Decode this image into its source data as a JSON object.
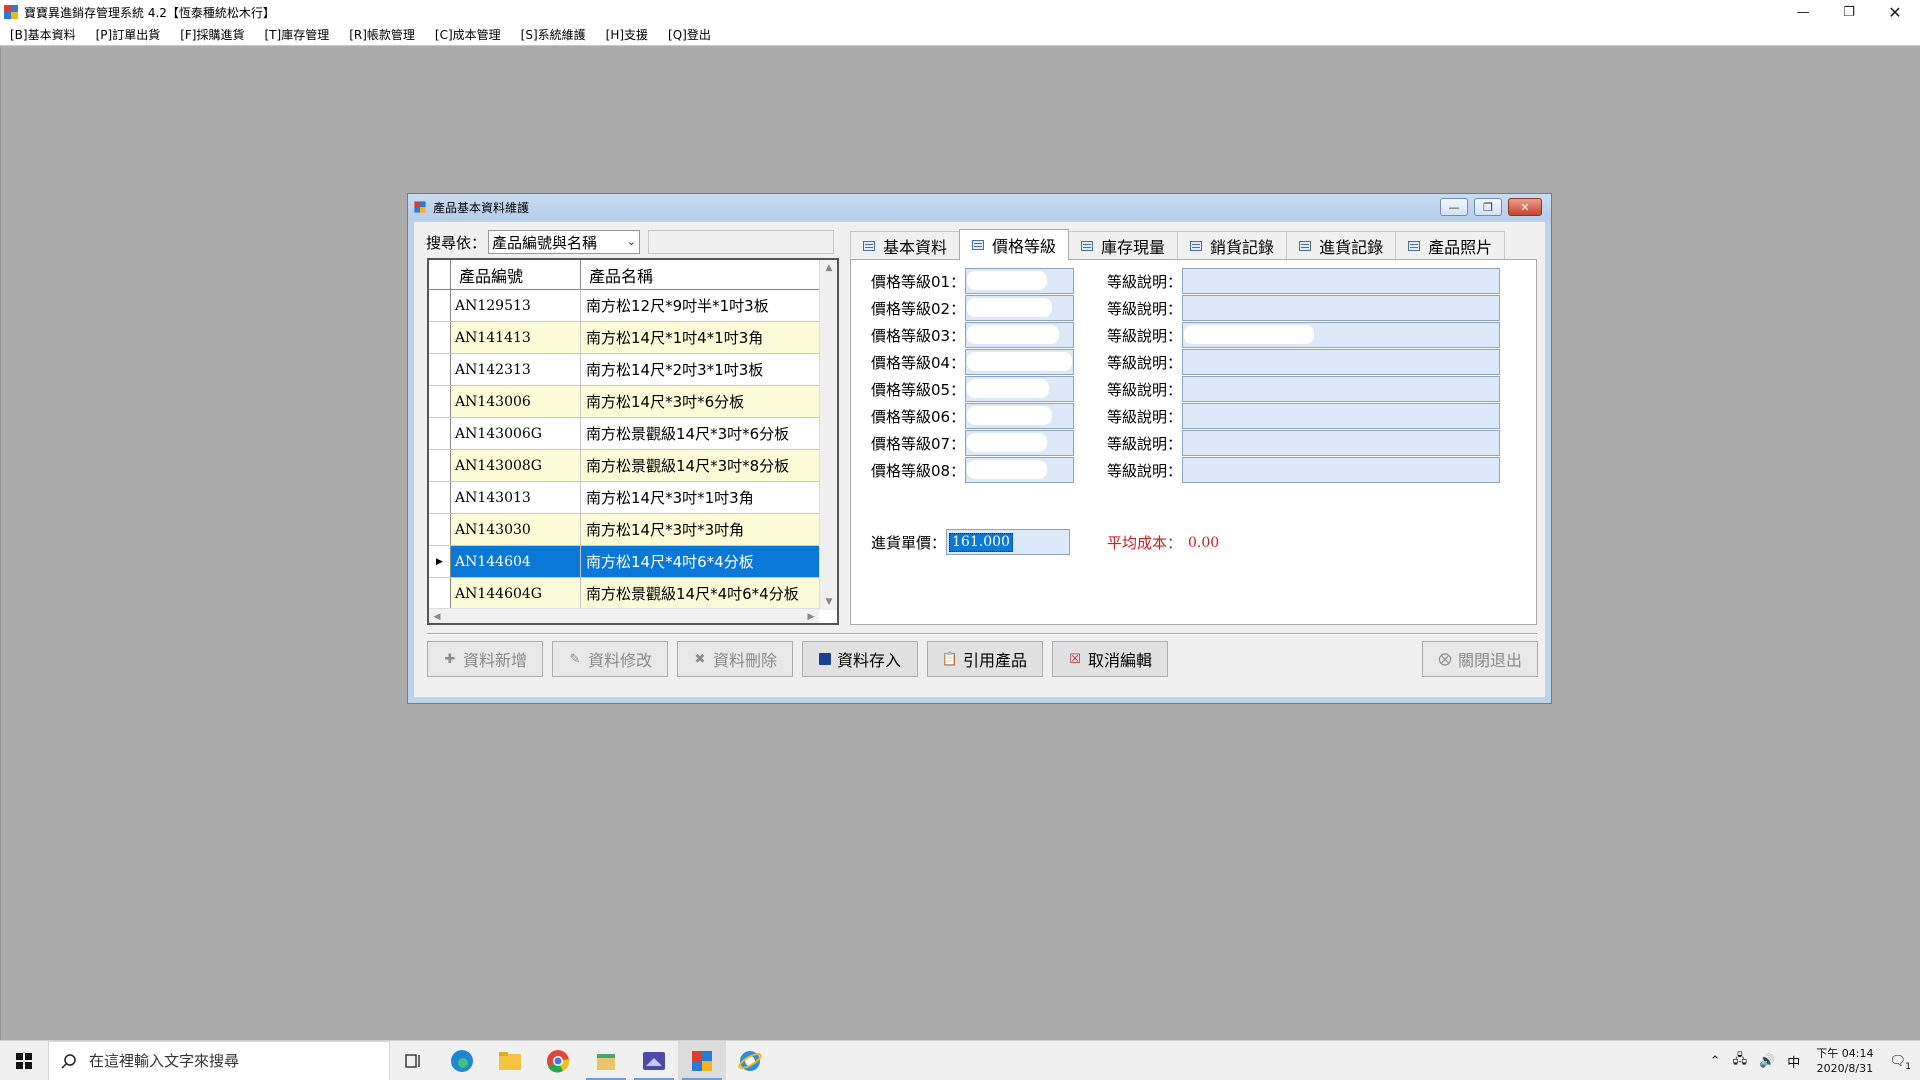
{
  "app": {
    "title": "寶寶異進銷存管理系統 4.2【恆泰種統松木行】"
  },
  "menu": {
    "items": [
      "[B]基本資料",
      "[P]訂單出貨",
      "[F]採購進貨",
      "[T]庫存管理",
      "[R]帳款管理",
      "[C]成本管理",
      "[S]系統維護",
      "[H]支援",
      "[Q]登出"
    ]
  },
  "dialog": {
    "title": "產品基本資料維護",
    "search_label": "搜尋依：",
    "search_by": "產品編號與名稱",
    "search_value": "",
    "grid": {
      "columns": [
        "產品編號",
        "產品名稱"
      ],
      "rows": [
        {
          "code": "AN129513",
          "name": "南方松12尺*9吋半*1吋3板"
        },
        {
          "code": "AN141413",
          "name": "南方松14尺*1吋4*1吋3角"
        },
        {
          "code": "AN142313",
          "name": "南方松14尺*2吋3*1吋3板"
        },
        {
          "code": "AN143006",
          "name": "南方松14尺*3吋*6分板"
        },
        {
          "code": "AN143006G",
          "name": "南方松景觀級14尺*3吋*6分板"
        },
        {
          "code": "AN143008G",
          "name": "南方松景觀級14尺*3吋*8分板"
        },
        {
          "code": "AN143013",
          "name": "南方松14尺*3吋*1吋3角"
        },
        {
          "code": "AN143030",
          "name": "南方松14尺*3吋*3吋角"
        },
        {
          "code": "AN144604",
          "name": "南方松14尺*4吋6*4分板"
        },
        {
          "code": "AN144604G",
          "name": "南方松景觀級14尺*4吋6*4分板"
        }
      ],
      "selected_row": 8
    },
    "tabs": [
      "基本資料",
      "價格等級",
      "庫存現量",
      "銷貨記錄",
      "進貨記錄",
      "產品照片"
    ],
    "active_tab": "價格等級",
    "price_levels": [
      {
        "label": "價格等級01：",
        "desc_label": "等級說明："
      },
      {
        "label": "價格等級02：",
        "desc_label": "等級說明："
      },
      {
        "label": "價格等級03：",
        "desc_label": "等級說明："
      },
      {
        "label": "價格等級04：",
        "desc_label": "等級說明："
      },
      {
        "label": "價格等級05：",
        "desc_label": "等級說明："
      },
      {
        "label": "價格等級06：",
        "desc_label": "等級說明："
      },
      {
        "label": "價格等級07：",
        "desc_label": "等級說明："
      },
      {
        "label": "價格等級08：",
        "desc_label": "等級說明："
      }
    ],
    "purchase_price_label": "進貨單價：",
    "purchase_price": "161.000",
    "avg_cost_label": "平均成本：",
    "avg_cost": "0.00",
    "buttons": {
      "add": "資料新增",
      "edit": "資料修改",
      "delete": "資料刪除",
      "save": "資料存入",
      "cite": "引用產品",
      "cancel": "取消編輯",
      "close": "關閉退出"
    }
  },
  "taskbar": {
    "search_placeholder": "在這裡輸入文字來搜尋",
    "ime": "中",
    "time_period": "下午 04:14",
    "date": "2020/8/31",
    "notification_count": "1"
  }
}
